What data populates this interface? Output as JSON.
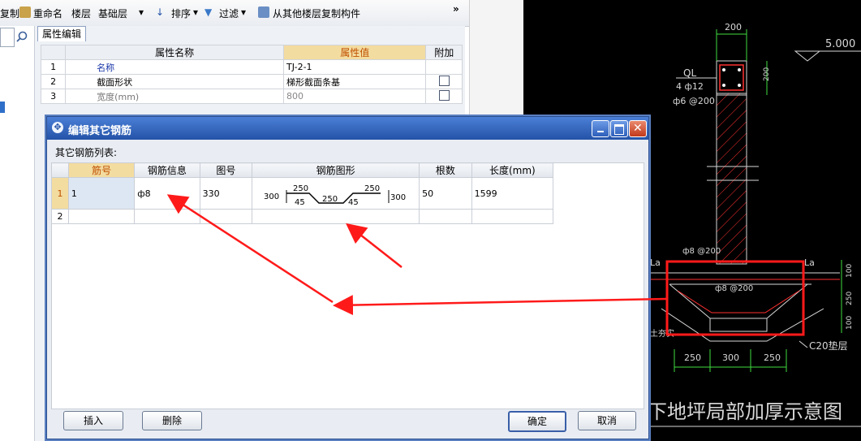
{
  "toolbar": {
    "items": [
      "复制",
      "重命名",
      "楼层",
      "基础层",
      "排序",
      "过滤",
      "从其他楼层复制构件"
    ],
    "overflow": "»"
  },
  "property_panel": {
    "tab": "属性编辑",
    "headers": [
      "属性名称",
      "属性值",
      "附加"
    ],
    "rows": [
      {
        "num": "1",
        "name": "名称",
        "value": "TJ-2-1"
      },
      {
        "num": "2",
        "name": "截面形状",
        "value": "梯形截面条基"
      },
      {
        "num": "3",
        "name": "宽度(mm)",
        "value": "800"
      }
    ]
  },
  "dialog": {
    "title": "编辑其它钢筋",
    "list_label": "其它钢筋列表:",
    "headers": [
      "筋号",
      "钢筋信息",
      "图号",
      "钢筋图形",
      "根数",
      "长度(mm)"
    ],
    "rows": [
      {
        "num": "1",
        "bar_no": "1",
        "info": "ф8",
        "fig_no": "330",
        "count": "50",
        "length": "1599"
      },
      {
        "num": "2",
        "bar_no": "",
        "info": "",
        "fig_no": "",
        "count": "",
        "length": ""
      }
    ],
    "shape": {
      "left": "300",
      "d1": "45",
      "top1": "250",
      "mid": "250",
      "d2": "45",
      "top2": "250",
      "right": "300"
    },
    "buttons": {
      "insert": "插入",
      "delete": "删除",
      "ok": "确定",
      "cancel": "取消"
    }
  },
  "cad": {
    "dim_200_top": "200",
    "elev": "5.000",
    "ql": "QL",
    "ql_bars": "4 ф12",
    "ql_stirrup": "ф6 @200",
    "dim_200_side": "200",
    "bar_label_1": "ф8 @200",
    "bar_label_2": "ф8 @200",
    "la_left": "La",
    "la_right": "La",
    "right_dims": [
      "100",
      "250",
      "100"
    ],
    "bottom_dims": [
      "250",
      "300",
      "250"
    ],
    "c20": "C20垫层",
    "soil": "土夯实",
    "caption": "下地坪局部加厚示意图"
  },
  "colors": {
    "annotation_red": "#ff1a1a",
    "cad_green": "#3fdc3f",
    "cad_bg": "#000000",
    "title_blue": "#2453a8"
  }
}
